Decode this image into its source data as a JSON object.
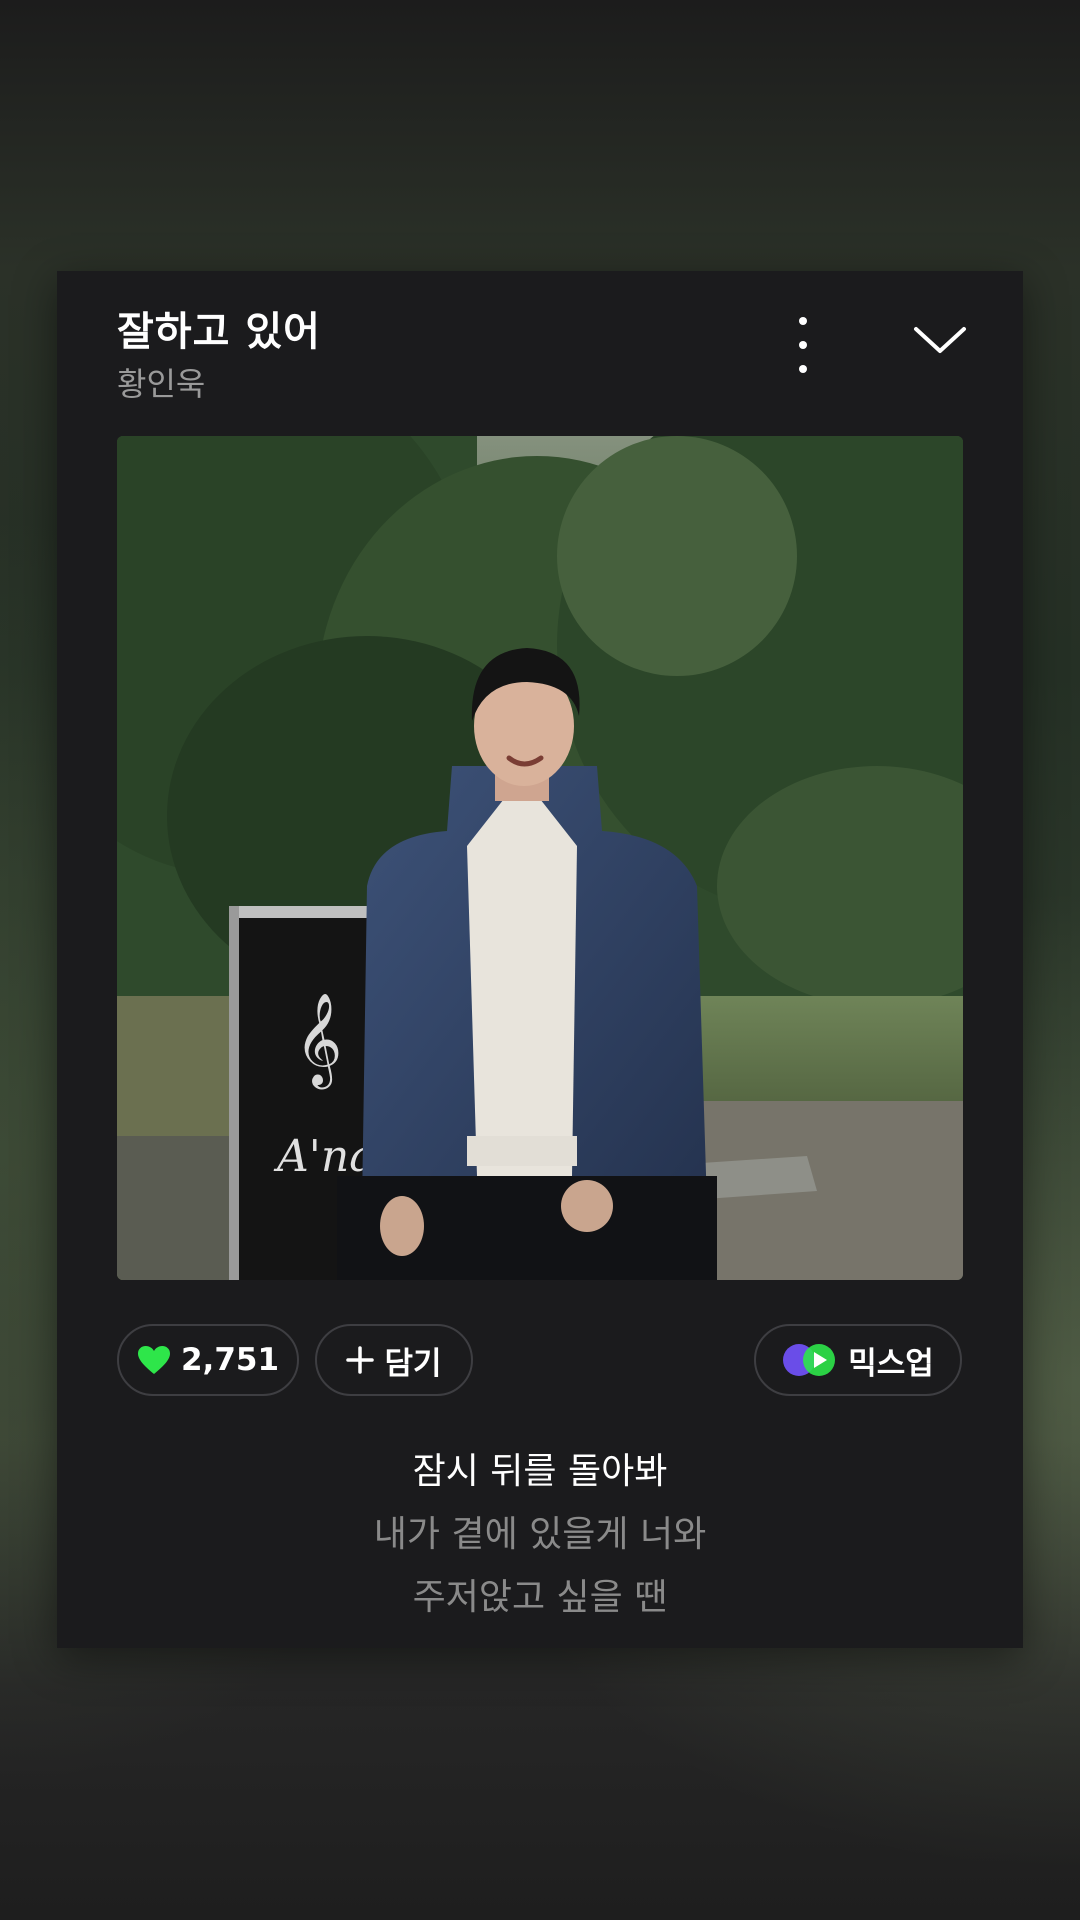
{
  "player": {
    "song_title": "잘하고 있어",
    "artist": "황인욱",
    "more_icon": "more-vertical-icon",
    "collapse_icon": "chevron-down-icon"
  },
  "actions": {
    "like_count": "2,751",
    "like_icon": "heart-icon",
    "like_color": "#2ee64a",
    "add_label": "담기",
    "add_icon": "plus-icon",
    "mixup_label": "믹스업",
    "mixup_icon": "mixup-logo-icon"
  },
  "lyrics": {
    "current": "잠시 뒤를 돌아봐",
    "next_1": "내가 곁에 있을게 너와",
    "next_2": "주저앉고 싶을 땐"
  },
  "artwork": {
    "sign_text": "A'na"
  }
}
